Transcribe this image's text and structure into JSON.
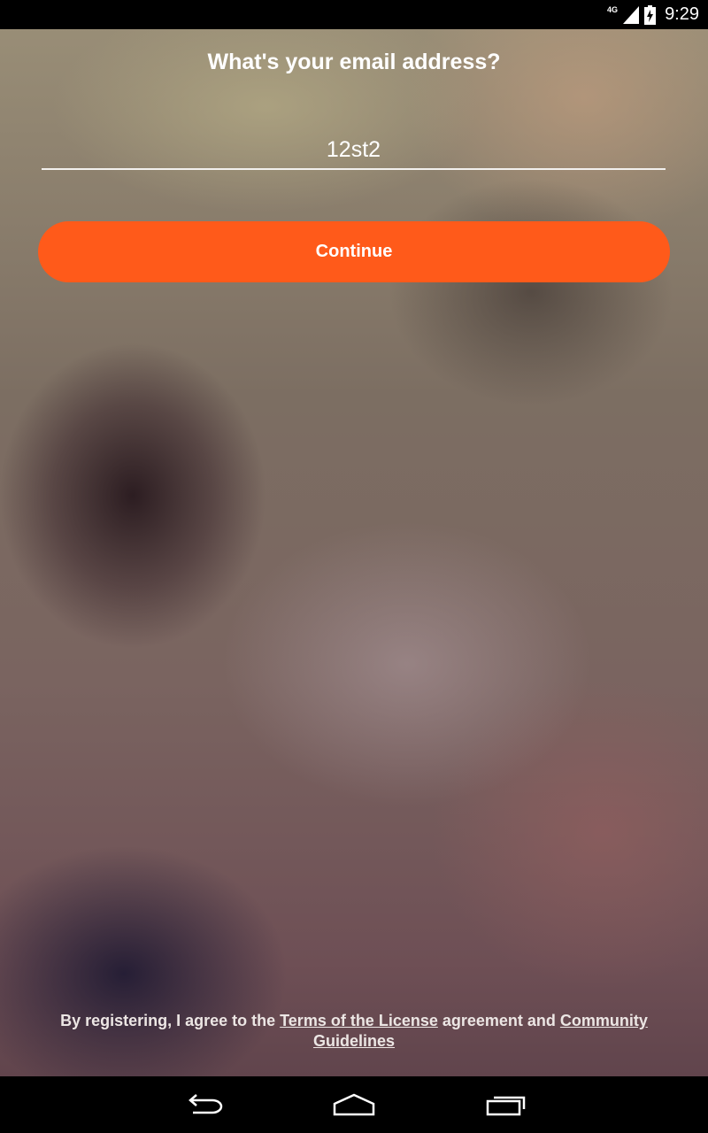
{
  "status_bar": {
    "network": "4G",
    "time": "9:29",
    "icons": [
      "signal-icon",
      "battery-charging-icon"
    ]
  },
  "main": {
    "title": "What's your email address?",
    "email_value": "12st2",
    "continue_label": "Continue"
  },
  "legal": {
    "prefix": "By registering, I agree to the ",
    "terms_link": "Terms of the License",
    "middle": " agreement and ",
    "guidelines_link": "Community Guidelines"
  },
  "nav_bar": {
    "icons": [
      "back-icon",
      "home-icon",
      "recent-apps-icon"
    ]
  },
  "colors": {
    "accent": "#ff5a1a",
    "status_bar": "#000000",
    "text": "#ffffff"
  }
}
